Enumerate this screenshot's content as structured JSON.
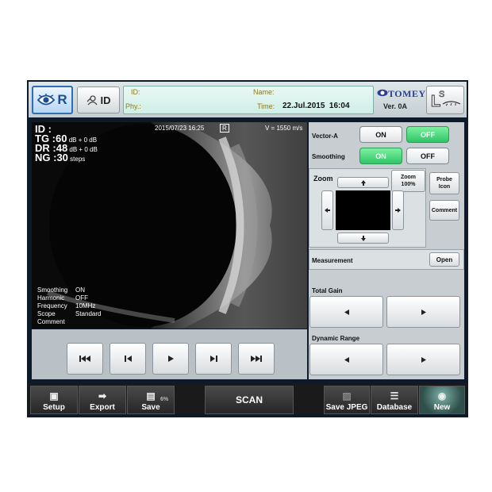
{
  "header": {
    "side": "R",
    "id_button": "ID",
    "id_label": "ID:",
    "name_label": "Name:",
    "phy_label": "Phy.:",
    "time_label": "Time:",
    "time_value": "22.Jul.2015  16:04",
    "brand": "TOMEY",
    "version": "Ver. 0A",
    "ls_label": "LS"
  },
  "image": {
    "id_line": "ID :",
    "tg_label": "TG :",
    "tg_value": "60",
    "tg_unit": "dB + 0 dB",
    "dr_label": "DR :",
    "dr_value": "48",
    "dr_unit": "dB + 0 dB",
    "ng_label": "NG :",
    "ng_value": "30",
    "ng_unit": "steps",
    "datetime": "2015/07/23 16:25",
    "side_tag": "R",
    "velocity": "V = 1550 m/s",
    "settings": [
      {
        "name": "Smoothing",
        "value": "ON"
      },
      {
        "name": "Harmonic",
        "value": "OFF"
      },
      {
        "name": "Frequency",
        "value": "10MHz"
      },
      {
        "name": "Scope",
        "value": "Standard"
      },
      {
        "name": "Comment",
        "value": ""
      }
    ]
  },
  "panel": {
    "vector_a_label": "Vector-A",
    "vector_a_on": "ON",
    "vector_a_off": "OFF",
    "smoothing_label": "Smoothing",
    "smoothing_on": "ON",
    "smoothing_off": "OFF",
    "zoom_label": "Zoom",
    "zoom_100_line1": "Zoom",
    "zoom_100_line2": "100%",
    "probe_icon_line1": "Probe",
    "probe_icon_line2": "Icon",
    "comment": "Comment",
    "measurement_label": "Measurement",
    "open": "Open",
    "total_gain_label": "Total Gain",
    "dynamic_range_label": "Dynamic Range"
  },
  "bottom": {
    "setup": "Setup",
    "export": "Export",
    "save": "Save",
    "save_percent": "6%",
    "scan": "SCAN",
    "save_jpeg": "Save JPEG",
    "database": "Database",
    "new": "New"
  },
  "colors": {
    "on_green": "#2fc566",
    "accent_blue": "#2a6fb8",
    "frame_navy": "#0e1a2a"
  },
  "icons": {
    "eye": "eye-icon",
    "person": "person-icon",
    "first": "skip-first-icon",
    "prev": "step-back-icon",
    "play": "play-icon",
    "next": "step-forward-icon",
    "last": "skip-last-icon",
    "setup": "settings-screen-icon",
    "export": "export-arrow-icon",
    "save": "floppy-disk-icon",
    "save_jpeg": "image-save-icon",
    "database": "database-icon",
    "new": "new-patient-icon"
  }
}
